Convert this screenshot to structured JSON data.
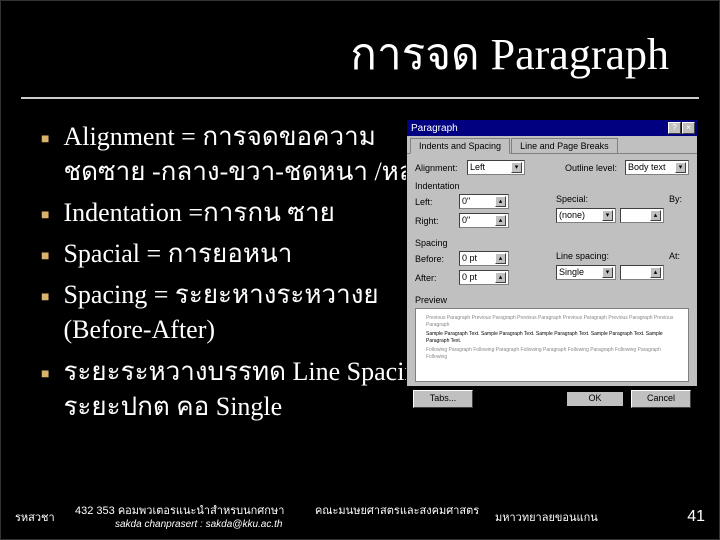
{
  "slide": {
    "title": "การจด  Paragraph",
    "bullets": [
      {
        "main": "Alignment = การจดขอความ",
        "sub": "ชดซาย  -กลาง-ขวา-ชดหนา  /หล"
      },
      {
        "main": "Indentation =การกน   ซาย"
      },
      {
        "main": "Spacial = การยอหนา"
      },
      {
        "main": "Spacing = ระยะหางระหวางย",
        "sub": "(Before-After)"
      },
      {
        "main": "ระยะระหวางบรรทด   Line Spacing",
        "sub": "ระยะปกต  คอ  Single"
      }
    ],
    "footer": {
      "code": "รหสวชา",
      "course": "432 353 คอมพวเตอรแนะนำสำหรบนกศกษา",
      "faculty": "คณะมนษยศาสตรและสงคมศาสตร",
      "author": "sakda chanprasert : sakda@kku.ac.th",
      "university": "มหาวทยาลยขอนแกน",
      "page": "41"
    }
  },
  "dialog": {
    "title": "Paragraph",
    "helpGlyph": "?",
    "closeGlyph": "×",
    "tabs": [
      "Indents and Spacing",
      "Line and Page Breaks"
    ],
    "alignment_label": "Alignment:",
    "alignment_value": "Left",
    "outline_label": "Outline level:",
    "outline_value": "Body text",
    "indent_group": "Indentation",
    "left_label": "Left:",
    "left_value": "0\"",
    "right_label": "Right:",
    "right_value": "0\"",
    "special_label": "Special:",
    "special_value": "(none)",
    "by_label": "By:",
    "by_value": "",
    "spacing_group": "Spacing",
    "before_label": "Before:",
    "before_value": "0 pt",
    "after_label": "After:",
    "after_value": "0 pt",
    "linespacing_label": "Line spacing:",
    "linespacing_value": "Single",
    "at_label": "At:",
    "at_value": "",
    "preview_label": "Preview",
    "tabs_btn": "Tabs...",
    "ok_btn": "OK",
    "cancel_btn": "Cancel"
  }
}
